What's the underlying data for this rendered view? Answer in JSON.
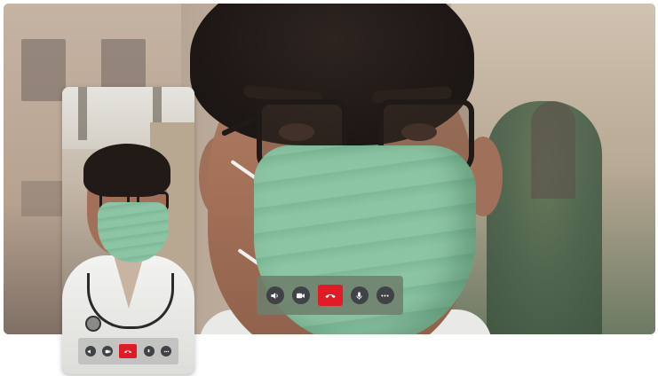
{
  "app": {
    "accent_end_call": "#e01b26",
    "control_bg": "#3f4246"
  },
  "main_call": {
    "controls": [
      {
        "name": "speaker-icon"
      },
      {
        "name": "camera-icon"
      },
      {
        "name": "end-call-icon"
      },
      {
        "name": "microphone-icon"
      },
      {
        "name": "more-options-icon"
      }
    ]
  },
  "self_view": {
    "controls": [
      {
        "name": "speaker-icon"
      },
      {
        "name": "camera-icon"
      },
      {
        "name": "end-call-icon"
      },
      {
        "name": "microphone-icon"
      },
      {
        "name": "more-options-icon"
      }
    ]
  }
}
